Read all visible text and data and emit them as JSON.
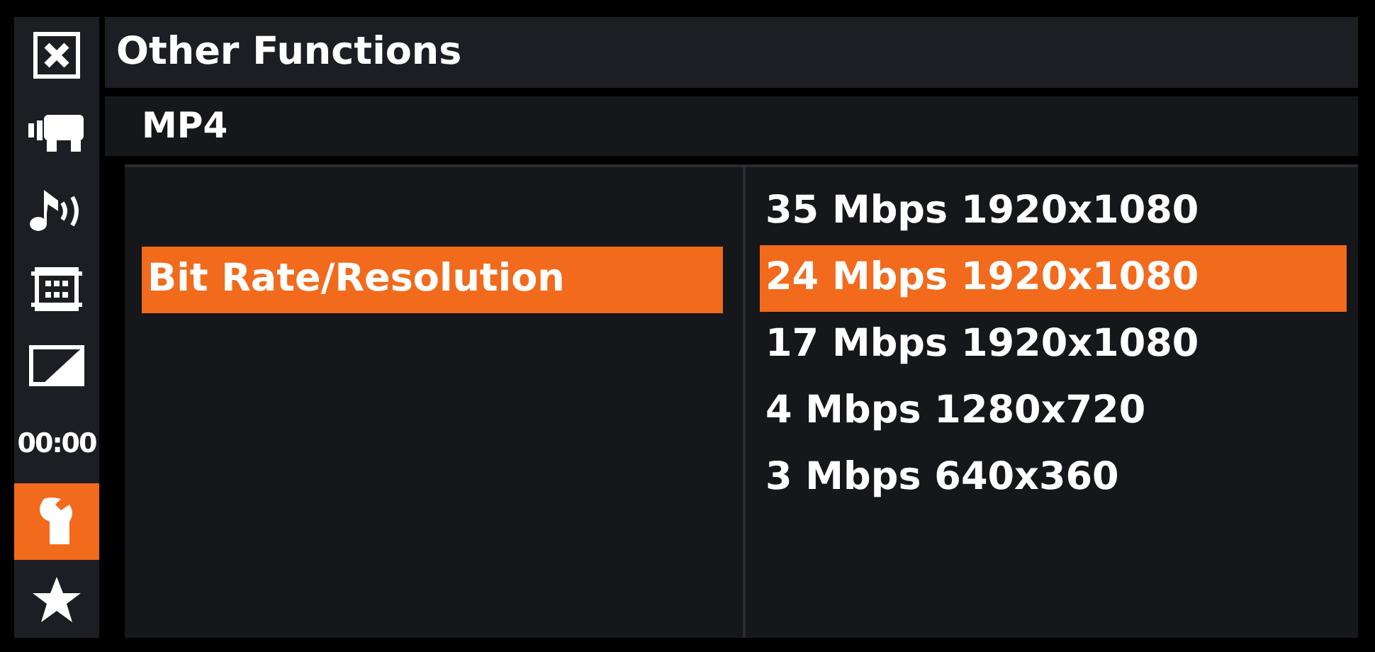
{
  "title": "Other Functions",
  "sidebar": [
    {
      "kind": "icon",
      "selected": false
    },
    {
      "kind": "icon",
      "selected": false
    },
    {
      "kind": "icon",
      "selected": false
    },
    {
      "kind": "icon",
      "selected": false
    },
    {
      "kind": "icon",
      "selected": false
    },
    {
      "kind": "text",
      "text": "00:00",
      "selected": false
    },
    {
      "kind": "icon",
      "selected": true
    },
    {
      "kind": "icon",
      "selected": false
    }
  ],
  "submenu": "MP4",
  "settings": [
    {
      "label": "Bit Rate/Resolution",
      "selected": true
    }
  ],
  "options": [
    {
      "label": "35 Mbps 1920x1080",
      "selected": false
    },
    {
      "label": "24 Mbps 1920x1080",
      "selected": true
    },
    {
      "label": "17 Mbps 1920x1080",
      "selected": false
    },
    {
      "label": "4 Mbps 1280x720",
      "selected": false
    },
    {
      "label": "3 Mbps 640x360",
      "selected": false
    }
  ]
}
